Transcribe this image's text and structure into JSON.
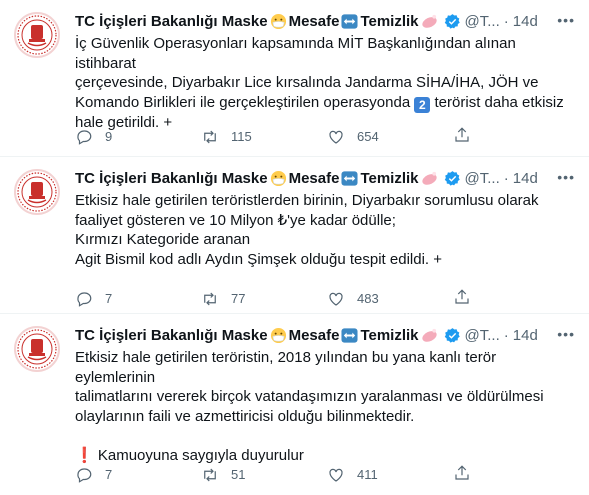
{
  "account": {
    "name_part1": "TC İçişleri Bakanlığı Maske",
    "name_part2": "Mesafe",
    "name_part3": "Temizlik",
    "handle": "@T...",
    "colors": {
      "verified": "#1d9bf0",
      "name": "#0f1419",
      "muted": "#536471",
      "avatar_red": "#c9302c"
    }
  },
  "tweets": [
    {
      "time": "14d",
      "lines": [
        "İç Güvenlik Operasyonları kapsamında MİT Başkanlığından alınan istihbarat",
        "çerçevesinde, Diyarbakır Lice kırsalında Jandarma SİHA/İHA, JÖH ve",
        "Komando Birlikleri ile gerçekleştirilen operasyonda",
        "terörist daha etkisiz",
        "hale getirildi. +"
      ],
      "keycap": "2",
      "replies": "9",
      "retweets": "115",
      "likes": "654"
    },
    {
      "time": "14d",
      "lines": [
        "Etkisiz hale getirilen teröristlerden birinin, Diyarbakır sorumlusu olarak",
        "faaliyet gösteren ve 10 Milyon ₺'ye kadar ödülle;",
        "Kırmızı Kategoride aranan",
        "Agit Bismil kod adlı Aydın Şimşek olduğu tespit edildi. +"
      ],
      "replies": "7",
      "retweets": "77",
      "likes": "483"
    },
    {
      "time": "14d",
      "lines": [
        "Etkisiz hale getirilen teröristin, 2018 yılından bu yana kanlı terör eylemlerinin",
        "talimatlarını vererek birçok vatandaşımızın yaralanması ve öldürülmesi",
        "olaylarının faili ve azmettiricisi olduğu bilinmektedir.",
        "Kamuoyuna saygıyla duyurulur"
      ],
      "excl": "❗",
      "replies": "7",
      "retweets": "51",
      "likes": "411"
    }
  ]
}
